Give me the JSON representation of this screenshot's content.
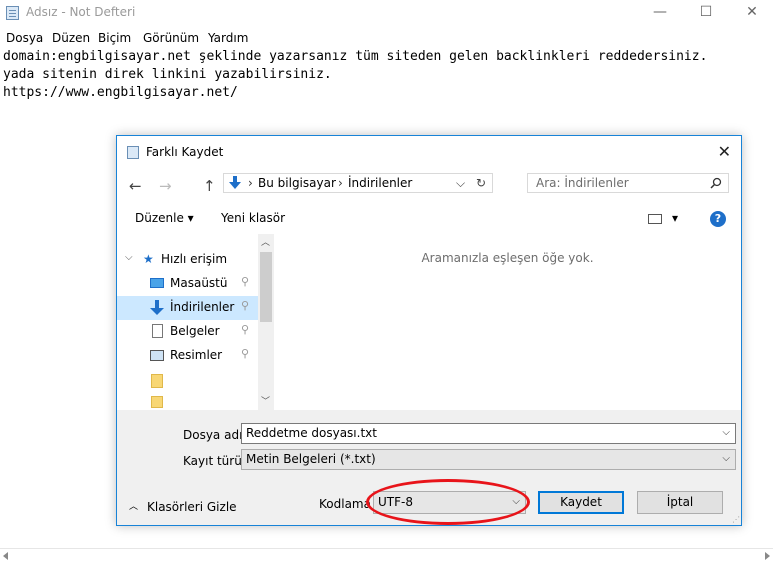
{
  "window": {
    "title": "Adsız - Not Defteri",
    "minimize_icon": "—",
    "maximize_icon": "☐",
    "close_icon": "✕"
  },
  "menu": [
    "Dosya",
    "Düzen",
    "Biçim",
    "Görünüm",
    "Yardım"
  ],
  "editor": {
    "lines": [
      "domain:engbilgisayar.net şeklinde yazarsanız tüm siteden gelen backlinkleri reddedersiniz.",
      "yada sitenin direk linkini yazabilirsiniz.",
      "https://www.engbilgisayar.net/"
    ]
  },
  "dialog": {
    "title": "Farklı Kaydet",
    "close_icon": "✕",
    "nav": {
      "back": "←",
      "forward": "→",
      "up": "↑"
    },
    "address": {
      "items": [
        "Bu bilgisayar",
        "İndirilenler"
      ],
      "separator": "›",
      "dropdown": "⌵",
      "refresh": "↻"
    },
    "search_placeholder": "Ara: İndirilenler",
    "toolbar": {
      "organize": "Düzenle ▾",
      "new_folder": "Yeni klasör",
      "view_dropdown": "▾",
      "help": "?"
    },
    "nav_pane": {
      "quick_access": "Hızlı erişim",
      "items": [
        {
          "label": "Masaüstü",
          "pinned": true
        },
        {
          "label": "İndirilenler",
          "pinned": true,
          "selected": true
        },
        {
          "label": "Belgeler",
          "pinned": true
        },
        {
          "label": "Resimler",
          "pinned": true
        }
      ],
      "pin_icon": "📌"
    },
    "empty_message": "Aramanızla eşleşen öğe yok.",
    "filename": {
      "label": "Dosya adı:",
      "value": "Reddetme dosyası.txt"
    },
    "filetype": {
      "label": "Kayıt türü:",
      "value": "Metin Belgeleri (*.txt)"
    },
    "hide_folders": "Klasörleri Gizle",
    "encoding": {
      "label": "Kodlama",
      "value": "UTF-8"
    },
    "save_button": "Kaydet",
    "cancel_button": "İptal",
    "highlight_color": "#e8141a"
  }
}
